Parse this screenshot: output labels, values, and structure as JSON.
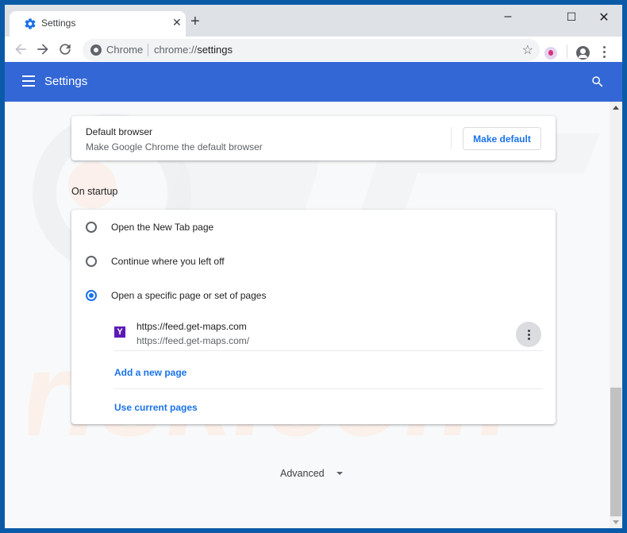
{
  "browser": {
    "tab": {
      "title": "Settings",
      "icon": "gear-icon",
      "close": "✕"
    },
    "new_tab_label": "+",
    "window_controls": {
      "minimize": "–",
      "maximize": "☐",
      "close": "✕"
    },
    "omnibox": {
      "site_chip": "Chrome",
      "url_scheme": "chrome://",
      "url_path": "settings"
    },
    "star_icon": "☆"
  },
  "header": {
    "title": "Settings"
  },
  "default_browser": {
    "title": "Default browser",
    "subtitle": "Make Google Chrome the default browser",
    "button": "Make default"
  },
  "on_startup": {
    "section_title": "On startup",
    "options": [
      {
        "label": "Open the New Tab page",
        "checked": false
      },
      {
        "label": "Continue where you left off",
        "checked": false
      },
      {
        "label": "Open a specific page or set of pages",
        "checked": true
      }
    ],
    "pages": [
      {
        "favicon": "Y",
        "favicon_color": "#5c1bb6",
        "title": "https://feed.get-maps.com",
        "url": "https://feed.get-maps.com/"
      }
    ],
    "add_page": "Add a new page",
    "use_current": "Use current pages"
  },
  "advanced": {
    "label": "Advanced"
  },
  "colors": {
    "header": "#3367d6",
    "accent": "#1a73e8",
    "frame": "#0a5aa8"
  },
  "watermark": "PC risk.com"
}
